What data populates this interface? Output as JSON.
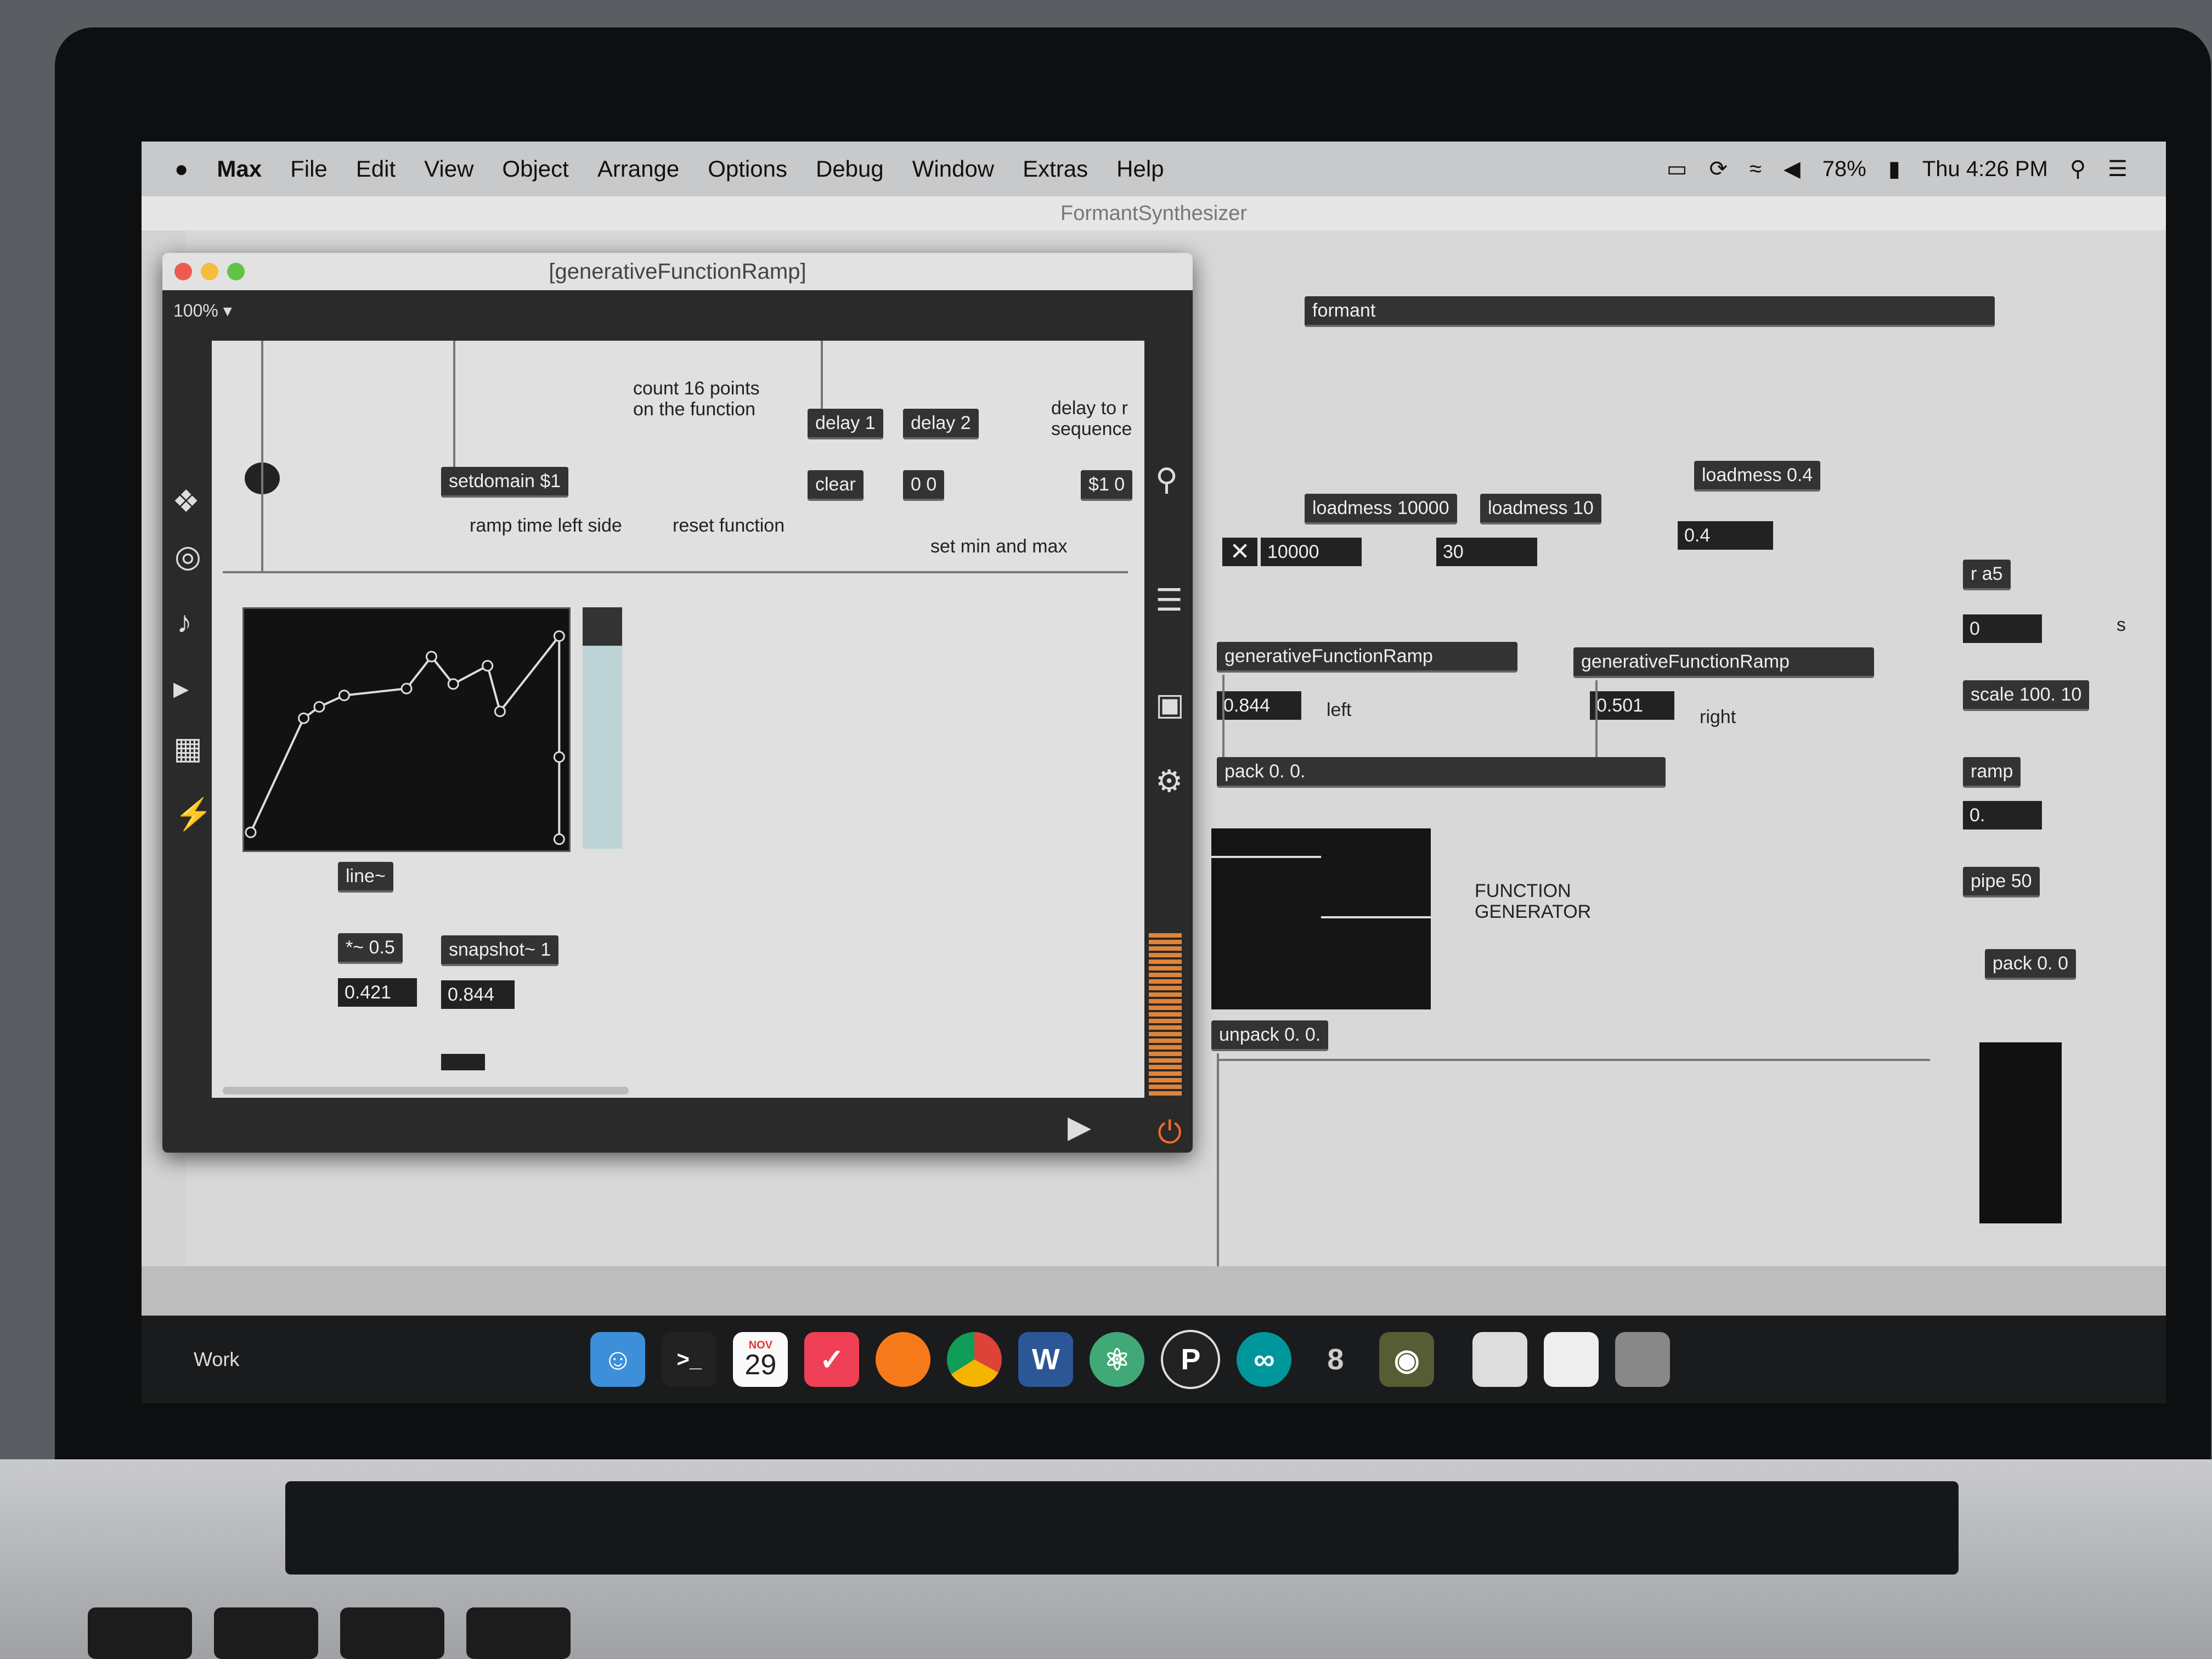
{
  "menubar": {
    "apple": "",
    "app": "Max",
    "items": [
      "File",
      "Edit",
      "View",
      "Object",
      "Arrange",
      "Options",
      "Debug",
      "Window",
      "Extras",
      "Help"
    ],
    "battery": "78%",
    "clock": "Thu 4:26 PM"
  },
  "main_window": {
    "title": "FormantSynthesizer"
  },
  "sub_window": {
    "title": "[generativeFunctionRamp]",
    "zoom": "100% ▾"
  },
  "sub_patch": {
    "comment_count": "count 16 points\non the function",
    "delay1": "delay 1",
    "delay2": "delay 2",
    "comment_delay": "delay to r\nsequence",
    "setdomain": "setdomain $1",
    "clear": "clear",
    "zero": "0 0",
    "s1": "$1 0",
    "comment_ramp": "ramp time left side",
    "comment_reset": "reset function",
    "comment_minmax": "set min and max",
    "line": "line~",
    "times": "*~ 0.5",
    "snapshot": "snapshot~ 1",
    "sig_value": "0.421",
    "snap_value": "0.844"
  },
  "function_points": [
    [
      0,
      0.05
    ],
    [
      0.17,
      0.55
    ],
    [
      0.22,
      0.6
    ],
    [
      0.3,
      0.65
    ],
    [
      0.5,
      0.68
    ],
    [
      0.58,
      0.82
    ],
    [
      0.65,
      0.7
    ],
    [
      0.76,
      0.78
    ],
    [
      0.8,
      0.58
    ],
    [
      0.99,
      0.91
    ],
    [
      0.99,
      0.38
    ],
    [
      0.99,
      0.02
    ]
  ],
  "main_patch": {
    "formant": "formant",
    "loadmess1": "loadmess 10000",
    "loadmess2": "loadmess 10",
    "loadmess3": "loadmess 0.4",
    "num1": "10000",
    "num2": "30",
    "num3": "0.4",
    "gfr_left": "generativeFunctionRamp",
    "gfr_right": "generativeFunctionRamp",
    "val_left": "0.844",
    "val_right": "0.501",
    "label_left": "left",
    "label_right": "right",
    "pack": "pack 0. 0.",
    "unpack": "unpack 0. 0.",
    "function_generator": "FUNCTION\nGENERATOR",
    "ra5": "r a5",
    "zero": "0",
    "scale": "scale 100. 10",
    "ramp": "ramp",
    "zero_f": "0.",
    "pipe": "pipe 50",
    "pack2": "pack 0. 0",
    "s_label": "s"
  },
  "dock": {
    "label": "Work",
    "calendar_month": "NOV",
    "calendar_day": "29",
    "items": [
      "Finder",
      "Terminal",
      "Calendar",
      "Pocket",
      "Firefox",
      "Chrome",
      "Word",
      "Atom",
      "P",
      "Arduino",
      "8",
      "Max",
      "Documents",
      "Preview",
      "Trash"
    ]
  }
}
